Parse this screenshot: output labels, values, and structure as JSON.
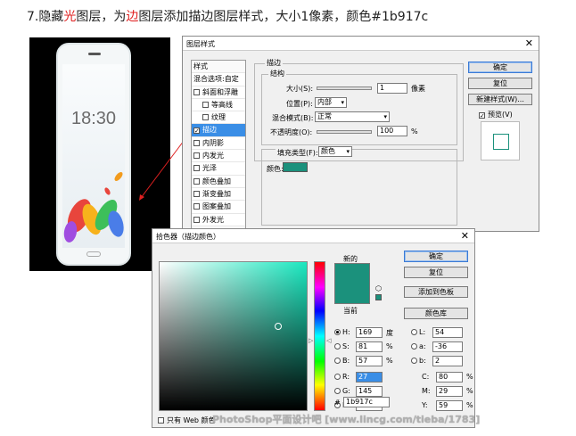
{
  "instruction": {
    "prefix": "7.隐藏",
    "w1": "光",
    "mid": "图层，为",
    "w2": "边",
    "suffix": "图层添加描边图层样式，大小1像素，颜色#1b917c"
  },
  "phone": {
    "time": "18:30"
  },
  "layer_style": {
    "title": "图层样式",
    "close": "✕",
    "styles_header": "样式",
    "styles": [
      {
        "label": "混合选项:自定",
        "checkbox": false,
        "checked": false,
        "selected": false,
        "indent": false
      },
      {
        "label": "斜面和浮雕",
        "checkbox": true,
        "checked": false,
        "selected": false,
        "indent": false
      },
      {
        "label": "等高线",
        "checkbox": true,
        "checked": false,
        "selected": false,
        "indent": true
      },
      {
        "label": "纹理",
        "checkbox": true,
        "checked": false,
        "selected": false,
        "indent": true
      },
      {
        "label": "描边",
        "checkbox": true,
        "checked": true,
        "selected": true,
        "indent": false
      },
      {
        "label": "内阴影",
        "checkbox": true,
        "checked": false,
        "selected": false,
        "indent": false
      },
      {
        "label": "内发光",
        "checkbox": true,
        "checked": false,
        "selected": false,
        "indent": false
      },
      {
        "label": "光泽",
        "checkbox": true,
        "checked": false,
        "selected": false,
        "indent": false
      },
      {
        "label": "颜色叠加",
        "checkbox": true,
        "checked": false,
        "selected": false,
        "indent": false
      },
      {
        "label": "渐变叠加",
        "checkbox": true,
        "checked": false,
        "selected": false,
        "indent": false
      },
      {
        "label": "图案叠加",
        "checkbox": true,
        "checked": false,
        "selected": false,
        "indent": false
      },
      {
        "label": "外发光",
        "checkbox": true,
        "checked": false,
        "selected": false,
        "indent": false
      }
    ],
    "stroke_title": "描边",
    "structure_title": "结构",
    "size_label": "大小(S):",
    "size_value": "1",
    "size_unit": "像素",
    "position_label": "位置(P):",
    "position_value": "内部",
    "blend_label": "混合模式(B):",
    "blend_value": "正常",
    "opacity_label": "不透明度(O):",
    "opacity_value": "100",
    "opacity_unit": "%",
    "fill_type_label": "填充类型(F):",
    "fill_type_value": "颜色",
    "color_label": "颜色:",
    "ok": "确定",
    "reset": "复位",
    "new_style": "新建样式(W)...",
    "preview": "预览(V)"
  },
  "color_picker": {
    "title": "拾色器（描边颜色）",
    "close": "✕",
    "new_label": "新的",
    "current_label": "当前",
    "ok": "确定",
    "reset": "复位",
    "add_swatch": "添加到色板",
    "libraries": "颜色库",
    "hsb": [
      {
        "key": "H:",
        "value": "169",
        "unit": "度",
        "on": true
      },
      {
        "key": "S:",
        "value": "81",
        "unit": "%",
        "on": false
      },
      {
        "key": "B:",
        "value": "57",
        "unit": "%",
        "on": false
      }
    ],
    "rgb": [
      {
        "key": "R:",
        "value": "27"
      },
      {
        "key": "G:",
        "value": "145"
      },
      {
        "key": "B:",
        "value": "124"
      }
    ],
    "lab": [
      {
        "key": "L:",
        "value": "54"
      },
      {
        "key": "a:",
        "value": "-36"
      },
      {
        "key": "b:",
        "value": "2"
      }
    ],
    "cmyk": [
      {
        "key": "C:",
        "value": "80",
        "unit": "%"
      },
      {
        "key": "M:",
        "value": "29",
        "unit": "%"
      },
      {
        "key": "Y:",
        "value": "59",
        "unit": "%"
      }
    ],
    "hex_label": "#",
    "hex_value": "1b917c",
    "web_only": "只有 Web 颜色"
  },
  "colors": {
    "stroke": "#1b917c",
    "accent_red": "#e02020"
  },
  "watermark": "PhotoShop平面设计吧 [www.lincg.com/tieba/1783]"
}
